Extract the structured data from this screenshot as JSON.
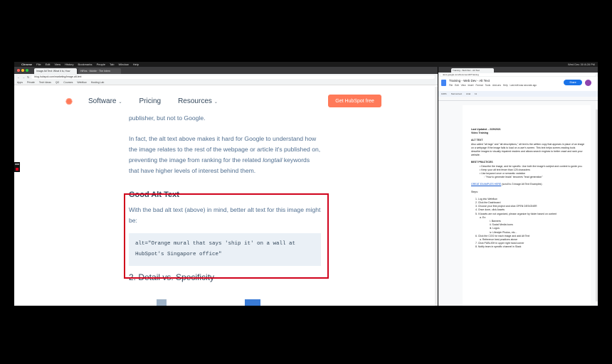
{
  "menubar": {
    "app": "Chrome",
    "items": [
      "File",
      "Edit",
      "View",
      "History",
      "Bookmarks",
      "People",
      "Tab",
      "Window",
      "Help"
    ],
    "clock": "Wed Dec 30 8:28 PM"
  },
  "left_browser": {
    "tabs": [
      "Image Alt Text: What it Is, How",
      "HiRes · Mobile · The Intern"
    ],
    "url": "blog.hubspot.com/marketing/image-alt-text",
    "bookmarks": [
      "Apps",
      "Private",
      "Tech Ideas",
      "QG",
      "Courses",
      "Webflow",
      "Hosting Lab"
    ],
    "header": {
      "nav": [
        {
          "label": "Software"
        },
        {
          "label": "Pricing"
        },
        {
          "label": "Resources"
        }
      ],
      "cta": "Get HubSpot free"
    },
    "article": {
      "p1": "publisher, but not to Google.",
      "p2_before": "In fact, the alt text above makes it hard for Google to understand how the image relates to the rest of the webpage or article it's published on, preventing the image from ranking for the related ",
      "p2_em": "longtail",
      "p2_after": " keywords that have higher levels of interest behind them.",
      "heading": "Good Alt Text",
      "p3": "With the bad alt text (above) in mind, better alt text for this image might be:",
      "code": "alt=\"Orange mural that says 'ship it' on a wall at HubSpot's Singapore office\"",
      "heading2": "2. Detail vs. Specificity"
    }
  },
  "right_browser": {
    "tab": "Training - Web Dev - Alt Text",
    "url": "docs.google.com/document/d/Training",
    "doc_title": "Training - Web Dev - Alt Text",
    "menu": [
      "File",
      "Edit",
      "View",
      "Insert",
      "Format",
      "Tools",
      "Add-ons",
      "Help",
      "Last edit was seconds ago"
    ],
    "share": "Share",
    "toolbar": [
      "100%",
      "Normal text",
      "Arial",
      "11"
    ],
    "doc": {
      "last_updated": "Last Updated – 2/29/2021",
      "video": "Video Training",
      "alt_head": "ALT TEXT",
      "alt_body": "Also called \"alt tags\" and \"alt descriptions,\" alt text is the written copy that appears in place of an image on a webpage if the image fails to load on a user's screen. This text helps screen-reading tools describe images to visually impaired readers and allows search engines to better crawl and rank your website.",
      "bp_head": "BEST PRACTICES",
      "bp": [
        "Describe the image, and be specific. Use both the image's subject and context to guide you.",
        "Keep your alt text fewer than 125 characters",
        "Use keyword once or semantic variation",
        "\"How to generate leads\" becomes \"lead generation\""
      ],
      "examples_link": "GREAT EXAMPLES HERE",
      "examples_rest": " (scroll to 3 image Alt Text Examples)",
      "steps_head": "Steps:",
      "steps": [
        "1.  Log into Webflow",
        "2.  Click the Dashboard",
        "3.  Choose your first project and click OPEN DESIGNER",
        "4.  Once done, click Assets",
        "5.  If Assets are not organized, please organize by folder based on content",
        "a.  Ex:",
        "i.  Banners",
        "ii.  Social Media Icons",
        "iii.  Logos",
        "iv.  Lifestyle Photos, etc...",
        "6.  Click the COG for each image and add Alt Text",
        "a.  Reference best practices above",
        "7.  Click PUBLISH in upper right hand corner",
        "8.  Notify team in specific channel in Slack"
      ]
    }
  }
}
